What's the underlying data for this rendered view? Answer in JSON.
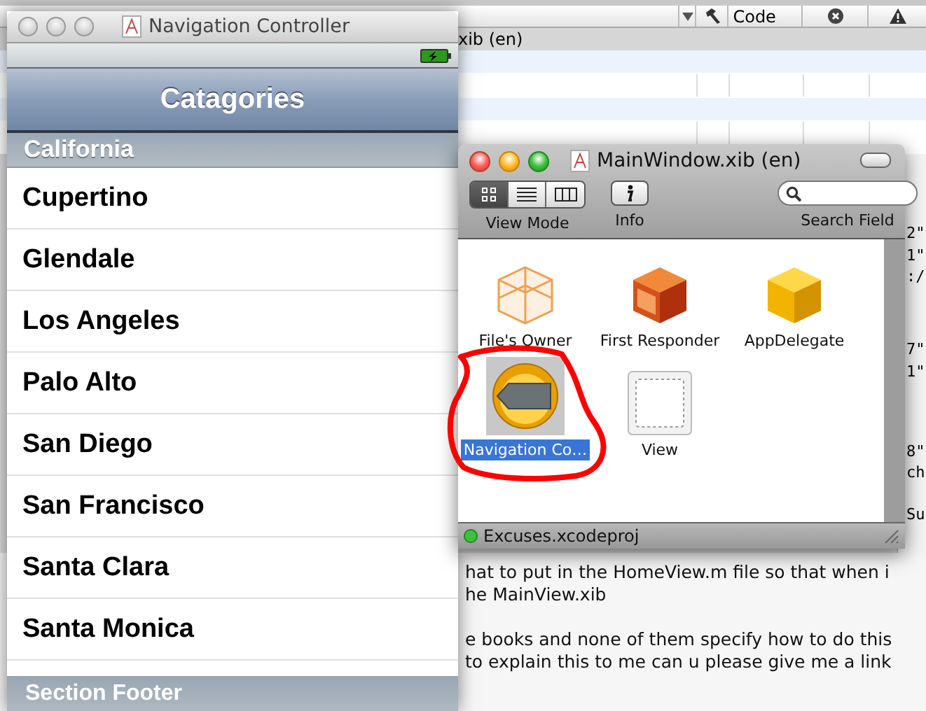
{
  "background_window": {
    "header": {
      "column_code": "Code"
    },
    "group_row": "xib (en)",
    "code_fragments": [
      "2\"",
      "1\"",
      ":/",
      "7\"",
      "1\"",
      "8\"",
      "ch",
      "Su"
    ],
    "question_lines": [
      "hat to put in the HomeView.m file so that when i",
      "he MainView.xib",
      "e books and none of them specify how to do this",
      "to explain this to me can u please give me a link"
    ]
  },
  "nav_window": {
    "title": "Navigation Controller",
    "nav_title": "Catagories",
    "section_header": "California",
    "rows": [
      "Cupertino",
      "Glendale",
      "Los Angeles",
      "Palo Alto",
      "San Diego",
      "San Francisco",
      "Santa Clara",
      "Santa Monica"
    ],
    "section_footer": "Section Footer"
  },
  "xib_window": {
    "title": "MainWindow.xib (en)",
    "view_modes": [
      {
        "kind": "icons",
        "selected": true
      },
      {
        "kind": "list",
        "selected": false
      },
      {
        "kind": "columns",
        "selected": false
      }
    ],
    "toolbar_labels": {
      "view_mode": "View Mode",
      "info": "Info",
      "search": "Search Field"
    },
    "objects": [
      {
        "label": "File's Owner",
        "kind": "outline-cube",
        "selected": false
      },
      {
        "label": "First Responder",
        "kind": "responder-cube",
        "selected": false
      },
      {
        "label": "AppDelegate",
        "kind": "solid-cube",
        "selected": false
      },
      {
        "label": "Navigation Co…",
        "kind": "nav-controller",
        "selected": true
      },
      {
        "label": "View",
        "kind": "view",
        "selected": false
      }
    ],
    "status": "Excuses.xcodeproj"
  }
}
